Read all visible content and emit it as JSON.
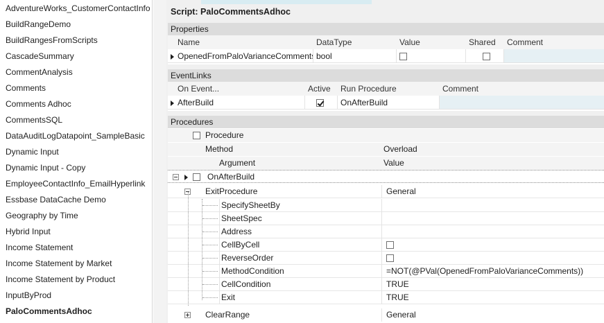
{
  "scripts_list": {
    "items": [
      "AdventureWorks_CustomerContactInfo",
      "BuildRangeDemo",
      "BuildRangesFromScripts",
      "CascadeSummary",
      "CommentAnalysis",
      "Comments",
      "Comments Adhoc",
      "CommentsSQL",
      "DataAuditLogDatapoint_SampleBasic",
      "Dynamic Input",
      "Dynamic Input - Copy",
      "EmployeeContactInfo_EmailHyperlink",
      "Essbase DataCache Demo",
      "Geography by Time",
      "Hybrid Input",
      "Income Statement",
      "Income Statement by Market",
      "Income Statement by Product",
      "InputByProd",
      "PaloCommentsAdhoc"
    ],
    "selected": "PaloCommentsAdhoc"
  },
  "script": {
    "title": "Script: PaloCommentsAdhoc"
  },
  "properties": {
    "header": "Properties",
    "columns": [
      "Name",
      "DataType",
      "Value",
      "Shared",
      "Comment"
    ],
    "rows": [
      {
        "name": "OpenedFromPaloVarianceComments",
        "datatype": "bool",
        "value": false,
        "shared": false,
        "comment": ""
      }
    ]
  },
  "eventlinks": {
    "header": "EventLinks",
    "columns": [
      "On Event...",
      "Active",
      "Run Procedure",
      "Comment"
    ],
    "rows": [
      {
        "event": "AfterBuild",
        "active": true,
        "procedure": "OnAfterBuild",
        "comment": ""
      }
    ]
  },
  "procedures": {
    "header": "Procedures",
    "col_procedure": "Procedure",
    "col_method": "Method",
    "col_overload": "Overload",
    "col_argument": "Argument",
    "col_value": "Value",
    "procedure_name": "OnAfterBuild",
    "methods": [
      {
        "name": "ExitProcedure",
        "overload": "General",
        "expanded": true,
        "arguments": [
          {
            "name": "SpecifySheetBy",
            "value": ""
          },
          {
            "name": "SheetSpec",
            "value": ""
          },
          {
            "name": "Address",
            "value": ""
          },
          {
            "name": "CellByCell",
            "value": "",
            "checkbox": true
          },
          {
            "name": "ReverseOrder",
            "value": "",
            "checkbox": true
          },
          {
            "name": "MethodCondition",
            "value": "=NOT(@PVal(OpenedFromPaloVarianceComments))"
          },
          {
            "name": "CellCondition",
            "value": "TRUE"
          },
          {
            "name": "Exit",
            "value": "TRUE"
          }
        ]
      },
      {
        "name": "ClearRange",
        "overload": "General",
        "expanded": false
      }
    ]
  },
  "colors": {
    "section_header": "#dcdcdc",
    "row_tint": "#e6f0f4",
    "panel_bg": "#f0f0f0"
  }
}
